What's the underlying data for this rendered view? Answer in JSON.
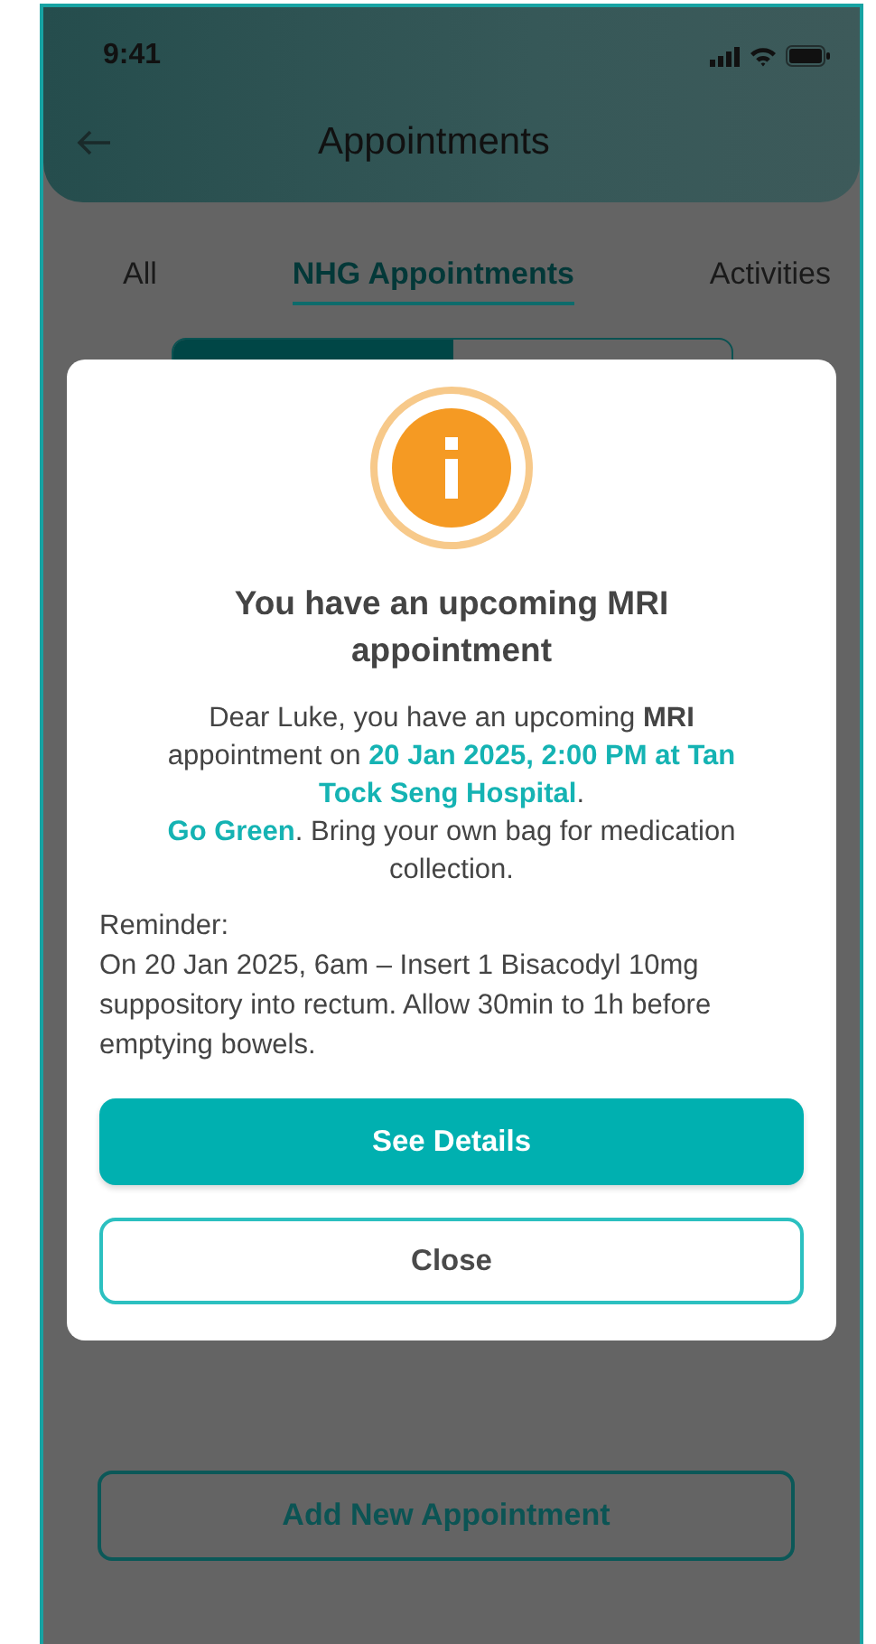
{
  "status_bar": {
    "time": "9:41"
  },
  "header": {
    "title": "Appointments"
  },
  "tabs": [
    {
      "label": "All",
      "selected": false
    },
    {
      "label": "NHG Appointments",
      "selected": true
    },
    {
      "label": "Activities",
      "selected": false
    }
  ],
  "segments": [
    {
      "selected": true
    },
    {
      "selected": false
    }
  ],
  "dialog": {
    "title": "You have an upcoming MRI appointment",
    "paragraphs": [
      [
        {
          "kind": "plain",
          "text": "Dear Luke, you have an upcoming "
        },
        {
          "kind": "bold",
          "text": "MRI"
        },
        {
          "kind": "plain",
          "text": " appointment on "
        },
        {
          "kind": "highlight",
          "text": "20 Jan 2025, 2:00 PM at Tan Tock Seng Hospital"
        },
        {
          "kind": "plain",
          "text": "."
        }
      ],
      [
        {
          "kind": "highlight",
          "text": "Go Green"
        },
        {
          "kind": "plain",
          "text": ". Bring your own bag for medication collection."
        }
      ]
    ],
    "reminder_label": "Reminder:",
    "reminder_text": "On 20 Jan 2025, 6am – Insert 1 Bisacodyl 10mg suppository into rectum. Allow 30min to 1h before emptying bowels.",
    "buttons": [
      {
        "label": "See Details",
        "kind": "primary"
      },
      {
        "label": "Close",
        "kind": "secondary"
      }
    ]
  },
  "add_button": {
    "label": "Add New Appointment"
  }
}
